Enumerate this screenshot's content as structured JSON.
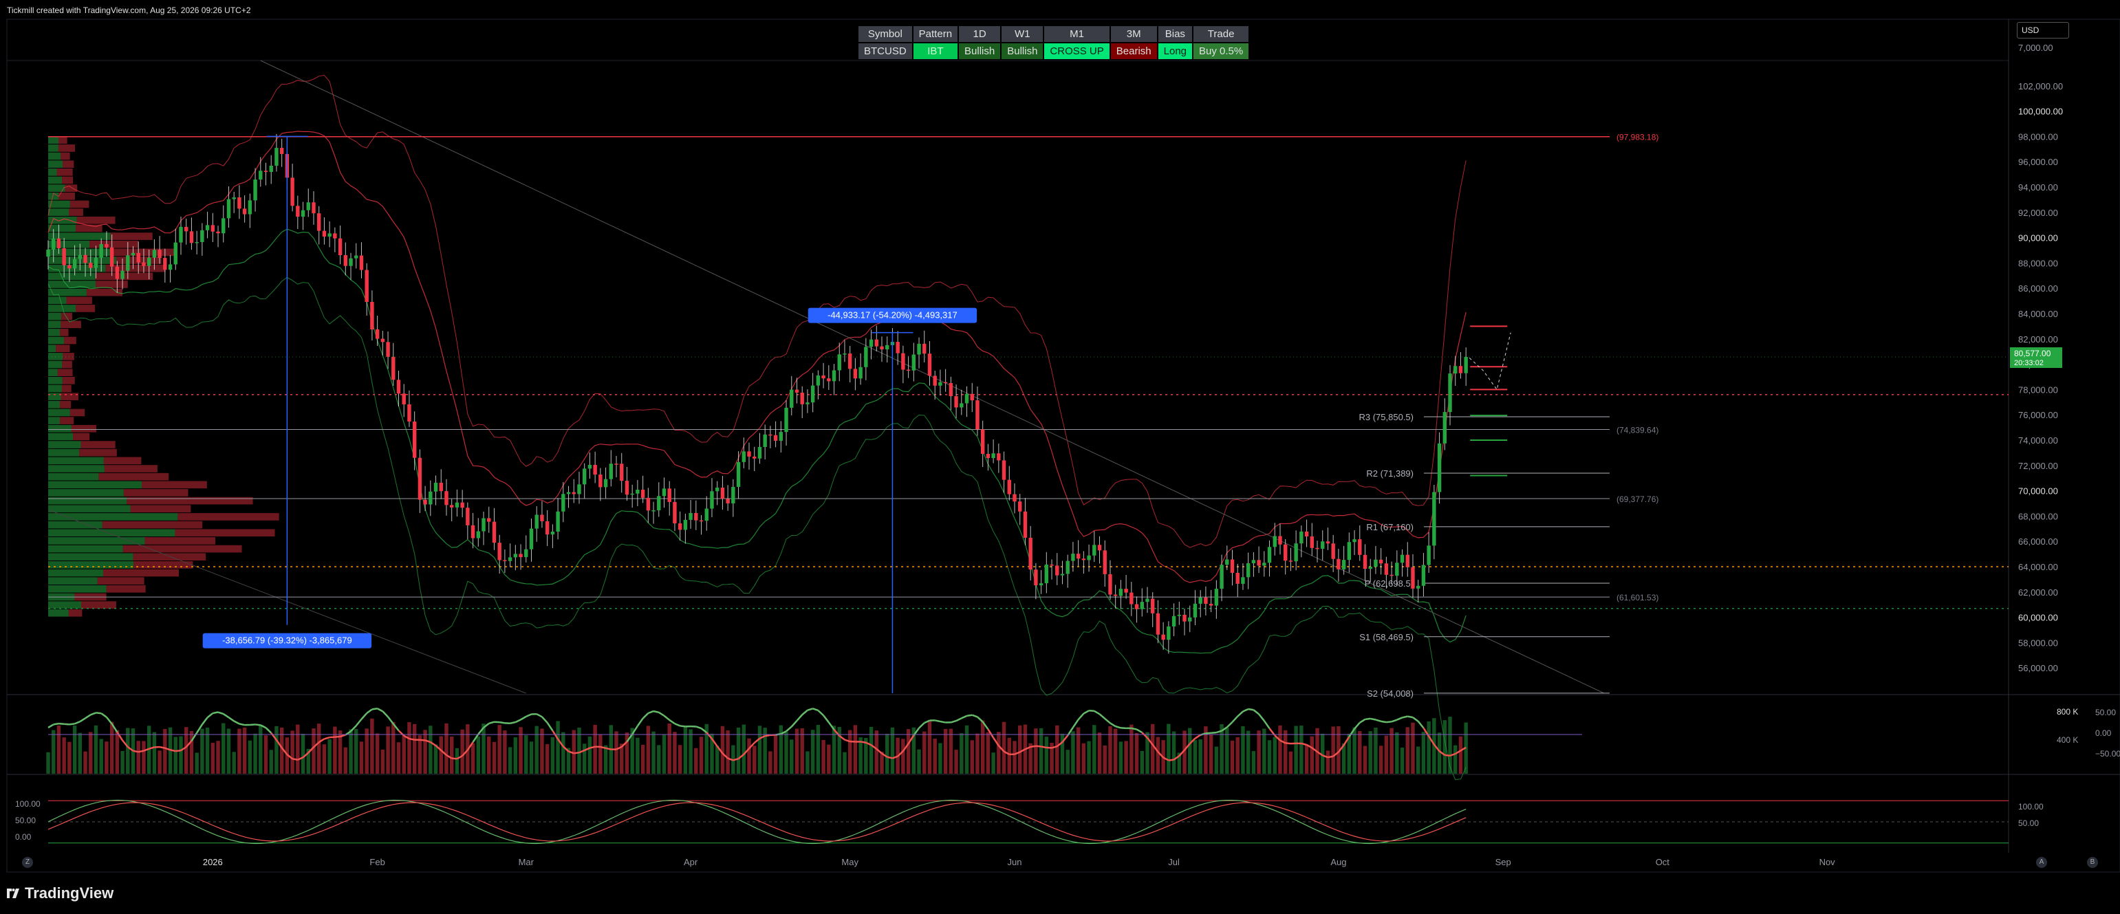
{
  "header": {
    "title": "Tickmill created with TradingView.com, Aug 25, 2026 09:26 UTC+2"
  },
  "currency_selector": {
    "value": "USD"
  },
  "brand": {
    "name": "TradingView"
  },
  "bias_table": {
    "headers": [
      "Symbol",
      "Pattern",
      "1D",
      "W1",
      "M1",
      "3M",
      "Bias",
      "Trade"
    ],
    "values": [
      {
        "text": "BTCUSD",
        "bg": "#3a3d45",
        "fg": "#e0e0e0"
      },
      {
        "text": "IBT",
        "bg": "#00c853",
        "fg": "#d0ffd8"
      },
      {
        "text": "Bullish",
        "bg": "#1b5e20",
        "fg": "#e0e0e0"
      },
      {
        "text": "Bullish",
        "bg": "#1b5e20",
        "fg": "#e0e0e0"
      },
      {
        "text": "CROSS UP",
        "bg": "#00e676",
        "fg": "#1a1a1a"
      },
      {
        "text": "Bearish",
        "bg": "#7f0000",
        "fg": "#e0e0e0"
      },
      {
        "text": "Long",
        "bg": "#00e676",
        "fg": "#1a1a1a"
      },
      {
        "text": "Buy 0.5%",
        "bg": "#2e7d32",
        "fg": "#e0e0e0"
      }
    ]
  },
  "colors": {
    "up": "#26a641",
    "down": "#f23645",
    "bg": "#000000",
    "grid": "#1e222d",
    "price_tag": "#089981",
    "measure": "#2962ff"
  },
  "axis_buttons": {
    "left": "Z",
    "right1": "A",
    "right2": "B"
  },
  "chart_data": {
    "type": "candlestick",
    "symbol": "BTCUSD",
    "price_axis": {
      "ticks": [
        "102,000.00",
        "100,000.00",
        "98,000.00",
        "96,000.00",
        "94,000.00",
        "92,000.00",
        "90,000.00",
        "88,000.00",
        "86,000.00",
        "84,000.00",
        "82,000.00",
        "80,000.00",
        "78,000.00",
        "76,000.00",
        "74,000.00",
        "72,000.00",
        "70,000.00",
        "68,000.00",
        "66,000.00",
        "64,000.00",
        "62,000.00",
        "60,000.00",
        "58,000.00",
        "56,000.00"
      ],
      "top_label": "7,000.00",
      "ylim": [
        54000,
        104000
      ]
    },
    "time_axis": [
      "2026",
      "Feb",
      "Mar",
      "Apr",
      "May",
      "Jun",
      "Jul",
      "Aug",
      "Sep",
      "Oct",
      "Nov"
    ],
    "last_price": {
      "value": "80,577.00",
      "countdown": "20:33:02",
      "numeric": 80577
    },
    "ohlc_keypoints": [
      {
        "date": "2025-12-01",
        "close": 88500
      },
      {
        "date": "2025-12-20",
        "close": 88000
      },
      {
        "date": "2026-01-05",
        "close": 92000
      },
      {
        "date": "2026-01-13",
        "close": 96500
      },
      {
        "date": "2026-01-18",
        "close": 92000
      },
      {
        "date": "2026-01-27",
        "close": 88500
      },
      {
        "date": "2026-02-05",
        "close": 78000
      },
      {
        "date": "2026-02-09",
        "close": 70500
      },
      {
        "date": "2026-02-18",
        "close": 68000
      },
      {
        "date": "2026-02-26",
        "close": 64500
      },
      {
        "date": "2026-03-07",
        "close": 68500
      },
      {
        "date": "2026-03-14",
        "close": 72000
      },
      {
        "date": "2026-03-23",
        "close": 69500
      },
      {
        "date": "2026-04-02",
        "close": 67500
      },
      {
        "date": "2026-04-14",
        "close": 73500
      },
      {
        "date": "2026-04-24",
        "close": 78500
      },
      {
        "date": "2026-05-07",
        "close": 81500
      },
      {
        "date": "2026-05-15",
        "close": 80000
      },
      {
        "date": "2026-05-24",
        "close": 76000
      },
      {
        "date": "2026-05-31",
        "close": 70000
      },
      {
        "date": "2026-06-06",
        "close": 62500
      },
      {
        "date": "2026-06-14",
        "close": 65500
      },
      {
        "date": "2026-06-22",
        "close": 61500
      },
      {
        "date": "2026-07-01",
        "close": 59000
      },
      {
        "date": "2026-07-10",
        "close": 63000
      },
      {
        "date": "2026-07-24",
        "close": 66000
      },
      {
        "date": "2026-08-07",
        "close": 64500
      },
      {
        "date": "2026-08-15",
        "close": 63200
      },
      {
        "date": "2026-08-18",
        "close": 65000
      },
      {
        "date": "2026-08-20",
        "close": 74000
      },
      {
        "date": "2026-08-22",
        "close": 78500
      },
      {
        "date": "2026-08-25",
        "close": 80577
      }
    ],
    "pivot_levels": [
      {
        "label": "R3 (75,850.5)",
        "value": 75850.5
      },
      {
        "label": "R2 (71,389)",
        "value": 71389
      },
      {
        "label": "R1 (67,160)",
        "value": 67160
      },
      {
        "label": "P (62,698.5)",
        "value": 62698.5
      },
      {
        "label": "S1 (58,469.5)",
        "value": 58469.5
      },
      {
        "label": "S2 (54,008)",
        "value": 54008
      }
    ],
    "right_levels": [
      {
        "label": "(97,983.18)",
        "value": 97983.18,
        "color": "#f23645"
      },
      {
        "label": "(74,839.64)",
        "value": 74839.64,
        "color": "#787b86"
      },
      {
        "label": "(69,377.76)",
        "value": 69377.76,
        "color": "#787b86"
      },
      {
        "label": "(61,601.53)",
        "value": 61601.53,
        "color": "#787b86"
      }
    ],
    "measurements": [
      {
        "label": "-38,656.79 (-39.32%) -3,865,679",
        "from": 98000,
        "to": 59400,
        "date": "2026-01-15"
      },
      {
        "label": "-44,933.17 (-54.20%) -4,493,317",
        "from": 82500,
        "to": 37500,
        "date": "2026-05-09"
      }
    ],
    "volume_axis": {
      "ticks": [
        "800 K",
        "400 K"
      ]
    },
    "oscillator1_axis": {
      "ticks": [
        "50.00",
        "0.00",
        "−50.00"
      ]
    },
    "oscillator2_axis": {
      "ticks": [
        "100.00",
        "50.00",
        "0.00"
      ],
      "right_ticks": [
        "100.00",
        "50.00"
      ]
    }
  }
}
